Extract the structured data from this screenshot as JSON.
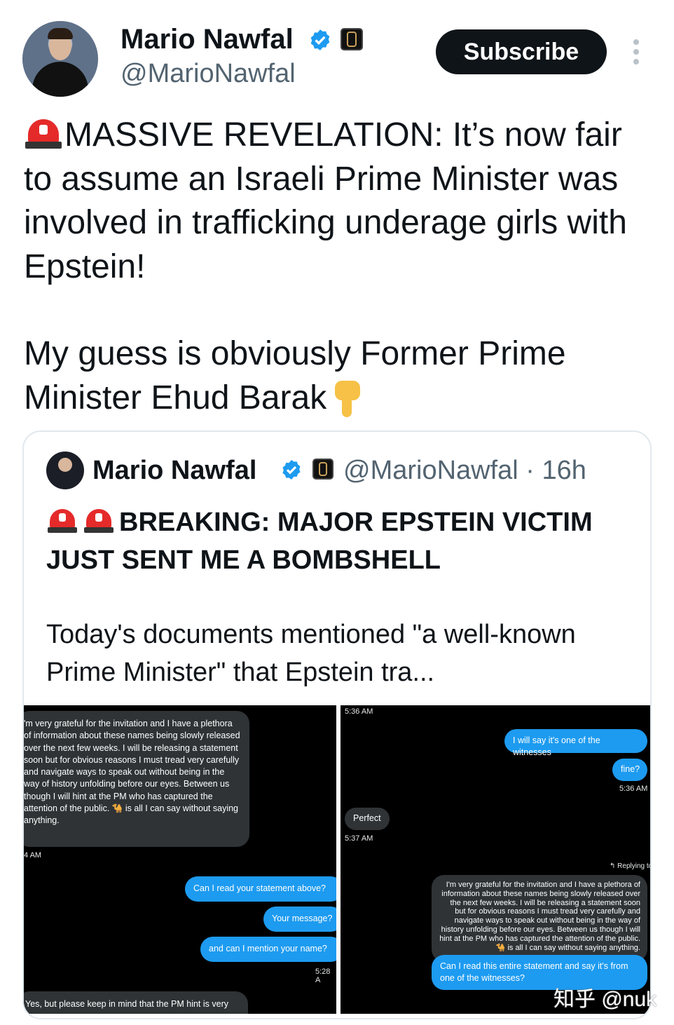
{
  "author": {
    "name": "Mario Nawfal",
    "handle": "@MarioNawfal",
    "subscribe_label": "Subscribe"
  },
  "tweet": {
    "paragraph1": "MASSIVE REVELATION: It’s now fair to assume an Israeli Prime Minister was involved in trafficking underage girls with Epstein!",
    "paragraph2": "My guess is obviously Former Prime Minister Ehud Barak"
  },
  "quoted": {
    "name": "Mario Nawfal",
    "handle_time": "@MarioNawfal · 16h",
    "headline": "BREAKING: MAJOR EPSTEIN VICTIM JUST SENT ME A BOMBSHELL",
    "body": "Today's documents mentioned \"a well-known Prime Minister\" that Epstein tra..."
  },
  "screenshot_left": {
    "message1": "'m very grateful for the invitation and I have a plethora of information about these names being slowly released over the next few weeks. I will be releasing a statement soon but for obvious reasons I must tread very carefully and navigate ways to speak out without being in the way of history unfolding before our eyes. Between us though I will hint at the PM who has captured the attention of the public. 🐪 is all I can say without saying anything.",
    "time1": "4 AM",
    "reply1": "Can I read your statement above?",
    "reply2": "Your message?",
    "reply3": "and can I mention your name?",
    "time2": "5:28 A",
    "message2": "Yes, but please keep in mind that the PM hint is very"
  },
  "screenshot_right": {
    "time_top": "5:36 AM",
    "sent1": "I will say it's one of the witnesses",
    "sent2": "fine?",
    "time_sent": "5:36 AM",
    "received": "Perfect",
    "time_received": "5:37 AM",
    "replying_label": "Replying to",
    "quoted_message": "I'm very grateful for the invitation and I have a plethora of information about these names being slowly released over the next few weeks. I will be releasing a statement soon but for obvious reasons I must tread very carefully and navigate ways to speak out without being in the way of history unfolding before our eyes. Between us though I will hint at the PM who has captured the attention of the public. 🐪 is all I can say without saying anything.",
    "sent3": "Can I read this entire statement and say it's from one of the witnesses?"
  },
  "watermark": "知乎 @nuk",
  "colors": {
    "accent_blue": "#1d9bf0",
    "text": "#0f1419",
    "secondary_text": "#536471",
    "dm_gray": "#2f3336"
  },
  "icons": [
    "siren-icon",
    "verified-badge-icon",
    "affiliate-badge-icon",
    "more-options-icon",
    "pointing-down-icon"
  ]
}
